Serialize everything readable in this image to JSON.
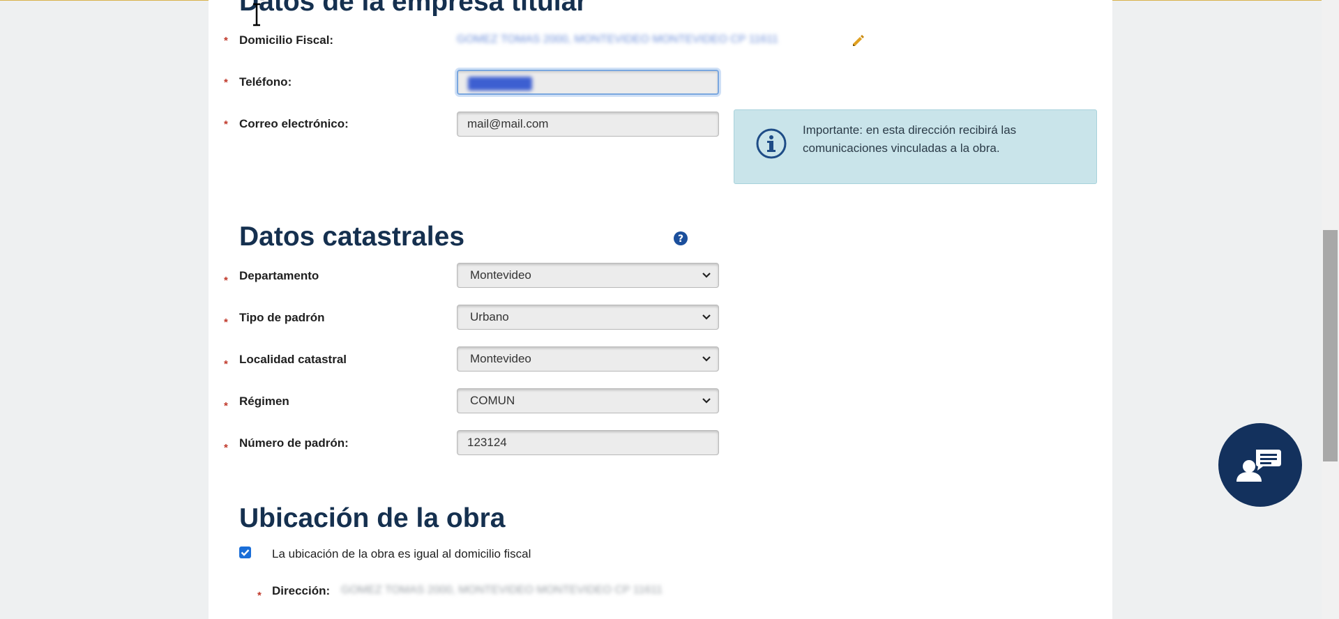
{
  "sections": {
    "empresa": {
      "title": "Datos de la empresa titular",
      "domicilio_label": "Domicilio Fiscal:",
      "domicilio_value": "GOMEZ TOMAS 2000, MONTEVIDEO MONTEVIDEO CP 11611",
      "telefono_label": "Teléfono:",
      "telefono_value": "",
      "correo_label": "Correo electrónico:",
      "correo_value": "mail@mail.com",
      "info_text": "Importante: en esta dirección recibirá las comunicaciones vinculadas a la obra."
    },
    "catastrales": {
      "title": "Datos catastrales",
      "departamento_label": "Departamento",
      "departamento_value": "Montevideo",
      "tipo_padron_label": "Tipo de padrón",
      "tipo_padron_value": "Urbano",
      "localidad_label": "Localidad catastral",
      "localidad_value": "Montevideo",
      "regimen_label": "Régimen",
      "regimen_value": "COMUN",
      "numero_padron_label": "Número de padrón:",
      "numero_padron_value": "123124"
    },
    "ubicacion": {
      "title": "Ubicación de la obra",
      "checkbox_label": "La ubicación de la obra es igual al domicilio fiscal",
      "checkbox_checked": true,
      "direccion_label": "Dirección:",
      "direccion_value": "GOMEZ TOMAS 2000, MONTEVIDEO MONTEVIDEO CP 11611"
    }
  },
  "required_marker": "*",
  "icons": {
    "edit": "pencil-icon",
    "info": "info-icon",
    "help": "question-icon",
    "chat": "chat-support-icon",
    "chevron": "chevron-down-icon"
  },
  "colors": {
    "heading": "#15304f",
    "required": "#c0392b",
    "info_bg": "#c9e4ea",
    "chat_button": "#13315d",
    "pencil": "#e0a020"
  }
}
